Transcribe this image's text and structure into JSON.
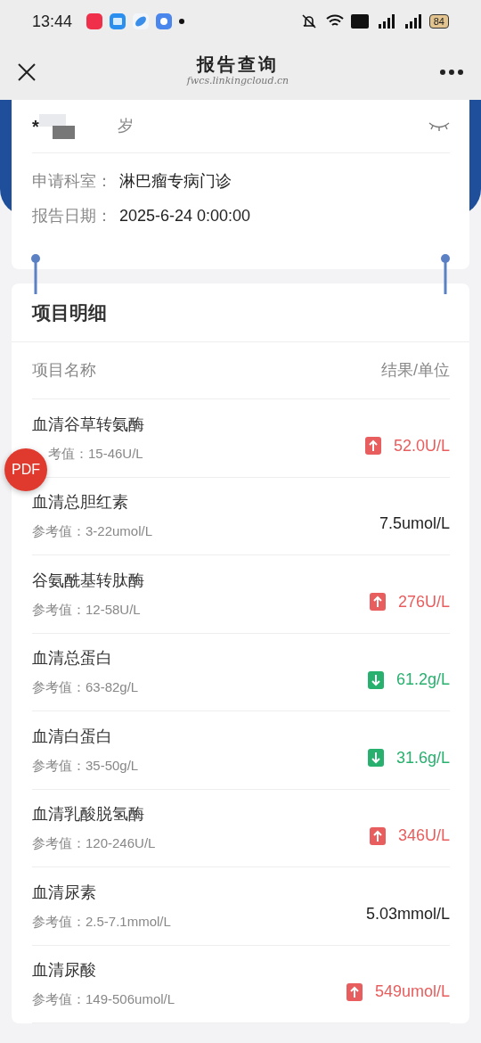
{
  "status_bar": {
    "time": "13:44",
    "battery": "84"
  },
  "header": {
    "title": "报告查询",
    "subtitle": "fwcs.linkingcloud.cn"
  },
  "patient": {
    "name": "*",
    "age": "岁"
  },
  "info": [
    {
      "label": "申请科室：",
      "value": "淋巴瘤专病门诊"
    },
    {
      "label": "报告日期：",
      "value": "2025-6-24 0:00:00"
    }
  ],
  "section_title": "项目明细",
  "columns": [
    "项目名称",
    "结果/单位"
  ],
  "items": [
    {
      "name": "血清谷草转氨酶",
      "reference": "考值：15-46U/L",
      "result": "52.0U/L",
      "kind": "high",
      "under_pdf_button": true
    },
    {
      "name": "血清总胆红素",
      "reference": "参考值：3-22umol/L",
      "result": "7.5umol/L",
      "kind": "normal"
    },
    {
      "name": "谷氨酰基转肽酶",
      "reference": "参考值：12-58U/L",
      "result": "276U/L",
      "kind": "high"
    },
    {
      "name": "血清总蛋白",
      "reference": "参考值：63-82g/L",
      "result": "61.2g/L",
      "kind": "low"
    },
    {
      "name": "血清白蛋白",
      "reference": "参考值：35-50g/L",
      "result": "31.6g/L",
      "kind": "low"
    },
    {
      "name": "血清乳酸脱氢酶",
      "reference": "参考值：120-246U/L",
      "result": "346U/L",
      "kind": "high"
    },
    {
      "name": "血清尿素",
      "reference": "参考值：2.5-7.1mmol/L",
      "result": "5.03mmol/L",
      "kind": "normal"
    },
    {
      "name": "血清尿酸",
      "reference": "参考值：149-506umol/L",
      "result": "549umol/L",
      "kind": "high"
    }
  ],
  "pdf_button": "PDF"
}
